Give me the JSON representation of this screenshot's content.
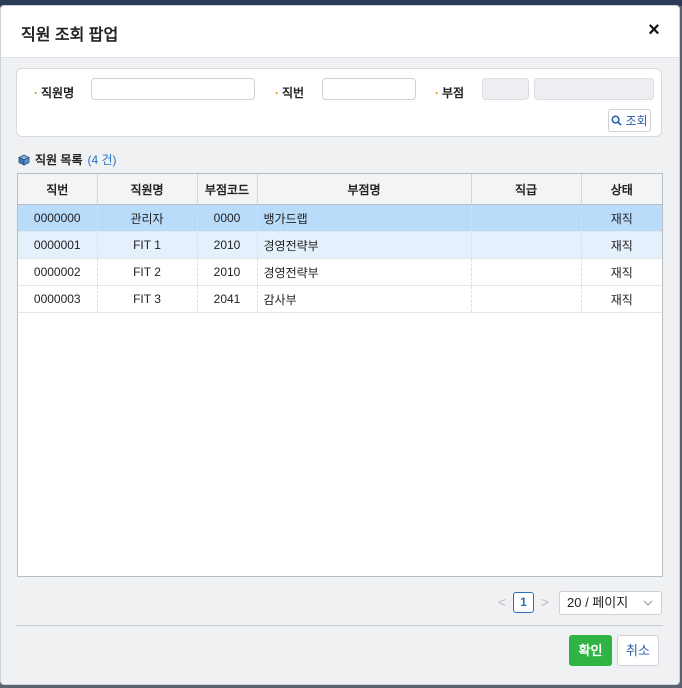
{
  "dialog": {
    "title": "직원 조회 팝업",
    "close_label": "×"
  },
  "search": {
    "name_label": "직원명",
    "name_value": "",
    "number_label": "직번",
    "number_value": "",
    "dept_label": "부점",
    "dept_code_value": "",
    "dept_name_value": "",
    "search_button_label": "조회"
  },
  "list": {
    "title": "직원 목록",
    "count_text": "(4 건)",
    "columns": [
      "직번",
      "직원명",
      "부점코드",
      "부점명",
      "직급",
      "상태"
    ],
    "rows": [
      [
        "0000000",
        "관리자",
        "0000",
        "뱅가드랩",
        "",
        "재직"
      ],
      [
        "0000001",
        "FIT 1",
        "2010",
        "경영전략부",
        "",
        "재직"
      ],
      [
        "0000002",
        "FIT 2",
        "2010",
        "경영전략부",
        "",
        "재직"
      ],
      [
        "0000003",
        "FIT 3",
        "2041",
        "감사부",
        "",
        "재직"
      ]
    ],
    "selected_row": 0
  },
  "pagination": {
    "prev": "<",
    "current_page": "1",
    "next": ">",
    "page_size": "20 / 페이지"
  },
  "footer": {
    "ok_label": "확인",
    "cancel_label": "취소"
  },
  "colors": {
    "selected_row": "#b9dcfb",
    "alt_row": "#e4f0fb",
    "ok_button": "#2fb344",
    "accent": "#2a6fc0"
  }
}
